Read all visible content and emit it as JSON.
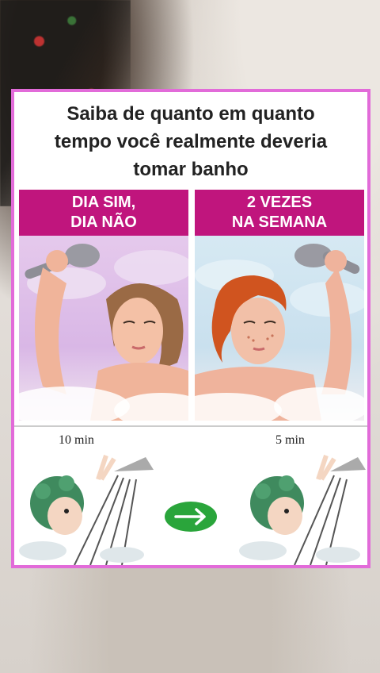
{
  "title_lines": [
    "Saiba de quanto em quanto",
    "tempo você realmente deveria",
    "tomar banho"
  ],
  "left": {
    "heading_lines": [
      "DIA SIM,",
      "DIA NÃO"
    ],
    "time": "10 min"
  },
  "right": {
    "heading_lines": [
      "2 VEZES",
      "NA SEMANA"
    ],
    "time": "5 min"
  },
  "colors": {
    "border": "#e26bd9",
    "header": "#c0157d",
    "arrow": "#2aa53b"
  }
}
